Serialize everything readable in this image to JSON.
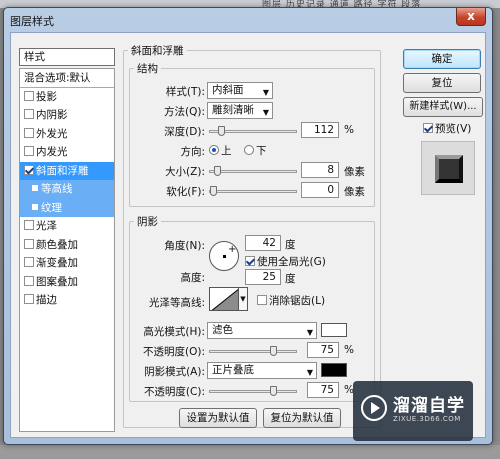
{
  "background": {
    "tabs": "图层  历史记录  通道  路径  字符  段落"
  },
  "window": {
    "title": "图层样式",
    "close": "x"
  },
  "sidebar": {
    "header": "样式",
    "items": [
      {
        "label": "混合选项:默认",
        "kind": "blend"
      },
      {
        "label": "投影",
        "kind": "check",
        "checked": false
      },
      {
        "label": "内阴影",
        "kind": "check",
        "checked": false
      },
      {
        "label": "外发光",
        "kind": "check",
        "checked": false
      },
      {
        "label": "内发光",
        "kind": "check",
        "checked": false
      },
      {
        "label": "斜面和浮雕",
        "kind": "check",
        "checked": true,
        "selected": true
      },
      {
        "label": "等高线",
        "kind": "sub"
      },
      {
        "label": "纹理",
        "kind": "sub"
      },
      {
        "label": "光泽",
        "kind": "check",
        "checked": false
      },
      {
        "label": "颜色叠加",
        "kind": "check",
        "checked": false
      },
      {
        "label": "渐变叠加",
        "kind": "check",
        "checked": false
      },
      {
        "label": "图案叠加",
        "kind": "check",
        "checked": false
      },
      {
        "label": "描边",
        "kind": "check",
        "checked": false
      }
    ]
  },
  "bevel": {
    "section_title": "斜面和浮雕",
    "structure_title": "结构",
    "style_label": "样式(T):",
    "style_value": "内斜面",
    "technique_label": "方法(Q):",
    "technique_value": "雕刻清晰",
    "depth_label": "深度(D):",
    "depth_value": "112",
    "depth_unit": "%",
    "depth_pct": 0.1,
    "direction_label": "方向:",
    "dir_up": "上",
    "dir_down": "下",
    "size_label": "大小(Z):",
    "size_value": "8",
    "size_unit": "像素",
    "size_pct": 0.05,
    "soften_label": "软化(F):",
    "soften_value": "0",
    "soften_unit": "像素",
    "soften_pct": 0.0,
    "shading_title": "阴影",
    "angle_label": "角度(N):",
    "angle_value": "42",
    "angle_unit": "度",
    "global_light_label": "使用全局光(G)",
    "altitude_label": "高度:",
    "altitude_value": "25",
    "altitude_unit": "度",
    "gloss_label": "光泽等高线:",
    "antialias_label": "消除锯齿(L)",
    "highlight_label": "高光模式(H):",
    "highlight_mode": "滤色",
    "highlight_color": "#ffffff",
    "opacity1_label": "不透明度(O):",
    "opacity1_value": "75",
    "opacity_unit": "%",
    "opacity1_pct": 0.75,
    "shadow_label": "阴影模式(A):",
    "shadow_mode": "正片叠底",
    "shadow_color": "#000000",
    "opacity2_label": "不透明度(C):",
    "opacity2_value": "75",
    "opacity2_pct": 0.75,
    "make_default": "设置为默认值",
    "reset_default": "复位为默认值"
  },
  "buttons": {
    "ok": "确定",
    "reset": "复位",
    "new_style": "新建样式(W)...",
    "preview": "预览(V)"
  },
  "watermark": {
    "title": "溜溜自学",
    "subtitle": "ZIXUE.3D66.COM"
  }
}
